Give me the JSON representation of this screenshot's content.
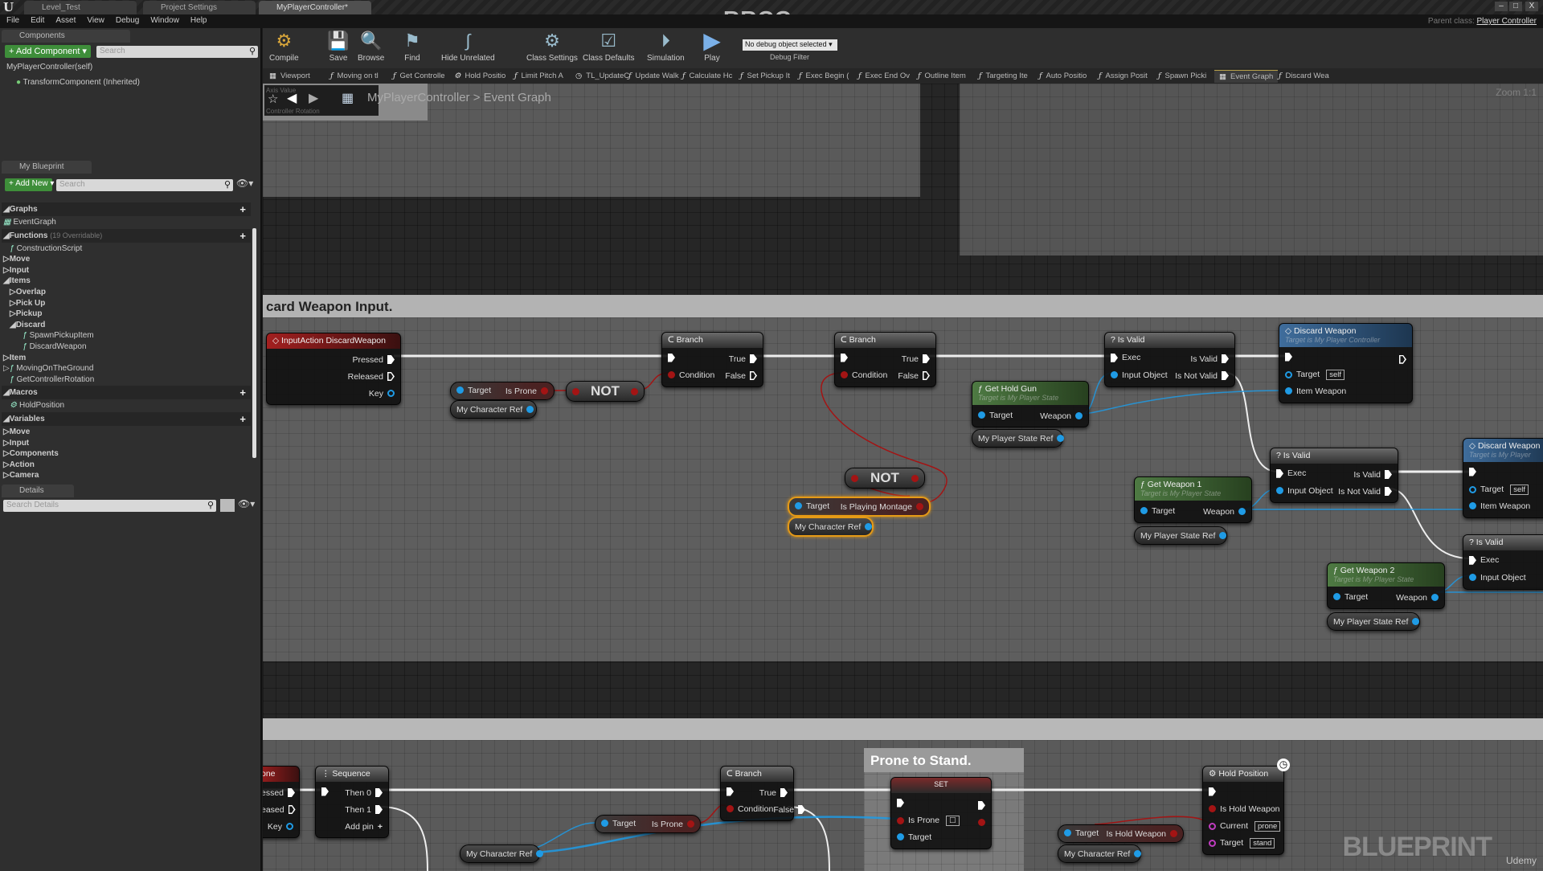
{
  "window": {
    "logo": "U",
    "watermark": "RRCG",
    "tabs": [
      "Level_Test",
      "Project Settings",
      "MyPlayerController*"
    ],
    "controls": [
      "–",
      "□",
      "X"
    ]
  },
  "menu": [
    "File",
    "Edit",
    "Asset",
    "View",
    "Debug",
    "Window",
    "Help"
  ],
  "parent_class": {
    "label": "Parent class:",
    "value": "Player Controller"
  },
  "components": {
    "tab": "Components",
    "add_button": "+ Add Component ▾",
    "search_placeholder": "Search",
    "items": [
      "MyPlayerController(self)",
      "TransformComponent (Inherited)"
    ]
  },
  "my_blueprint": {
    "tab": "My Blueprint",
    "add_button": "+ Add New ▾",
    "search_placeholder": "Search",
    "tree": [
      {
        "label": "Graphs",
        "kind": "hdr",
        "plus": true
      },
      {
        "label": "EventGraph",
        "kind": "item",
        "level": 0,
        "icon": "graph"
      },
      {
        "label": "Functions",
        "kind": "hdr",
        "plus": true,
        "note": "(19 Overridable)"
      },
      {
        "label": "ConstructionScript",
        "kind": "item",
        "level": 1,
        "icon": "func"
      },
      {
        "label": "Move",
        "kind": "cat",
        "level": 0,
        "arrow": "▷"
      },
      {
        "label": "Input",
        "kind": "cat",
        "level": 0,
        "arrow": "▷"
      },
      {
        "label": "Items",
        "kind": "cat",
        "level": 0,
        "arrow": "◢"
      },
      {
        "label": "Overlap",
        "kind": "cat",
        "level": 1,
        "arrow": "▷"
      },
      {
        "label": "Pick Up",
        "kind": "cat",
        "level": 1,
        "arrow": "▷"
      },
      {
        "label": "Pickup",
        "kind": "cat",
        "level": 1,
        "arrow": "▷"
      },
      {
        "label": "Discard",
        "kind": "cat",
        "level": 1,
        "arrow": "◢"
      },
      {
        "label": "SpawnPickupItem",
        "kind": "item",
        "level": 3,
        "icon": "func"
      },
      {
        "label": "DiscardWeapon",
        "kind": "item",
        "level": 3,
        "icon": "func"
      },
      {
        "label": "Item",
        "kind": "cat",
        "level": 0,
        "arrow": "▷"
      },
      {
        "label": "MovingOnTheGround",
        "kind": "item",
        "level": 0,
        "icon": "func",
        "arrow": "▷"
      },
      {
        "label": "GetControllerRotation",
        "kind": "item",
        "level": 1,
        "icon": "func"
      },
      {
        "label": "Macros",
        "kind": "hdr",
        "plus": true
      },
      {
        "label": "HoldPosition",
        "kind": "item",
        "level": 1,
        "icon": "macro"
      },
      {
        "label": "Variables",
        "kind": "hdr",
        "plus": true
      },
      {
        "label": "Move",
        "kind": "cat",
        "level": 0,
        "arrow": "▷"
      },
      {
        "label": "Input",
        "kind": "cat",
        "level": 0,
        "arrow": "▷"
      },
      {
        "label": "Components",
        "kind": "cat",
        "level": 0,
        "arrow": "▷"
      },
      {
        "label": "Action",
        "kind": "cat",
        "level": 0,
        "arrow": "▷"
      },
      {
        "label": "Camera",
        "kind": "cat",
        "level": 0,
        "arrow": "▷"
      }
    ]
  },
  "details": {
    "tab": "Details",
    "search_placeholder": "Search Details"
  },
  "toolbar": {
    "buttons": [
      "Compile",
      "Save",
      "Browse",
      "Find",
      "Hide Unrelated",
      "Class Settings",
      "Class Defaults",
      "Simulation",
      "Play"
    ],
    "debug_select": "No debug object selected ▾",
    "debug_filter": "Debug Filter"
  },
  "graph_tabs": [
    {
      "label": "Viewport",
      "icon": "viewport"
    },
    {
      "label": "Moving on tl",
      "icon": "func"
    },
    {
      "label": "Get Controlle",
      "icon": "func"
    },
    {
      "label": "Hold Positio",
      "icon": "macro"
    },
    {
      "label": "Limit Pitch A",
      "icon": "func"
    },
    {
      "label": "TL_UpdateC",
      "icon": "timeline"
    },
    {
      "label": "Update Walk",
      "icon": "func"
    },
    {
      "label": "Calculate Hc",
      "icon": "func"
    },
    {
      "label": "Set Pickup It",
      "icon": "func"
    },
    {
      "label": "Exec Begin (",
      "icon": "func"
    },
    {
      "label": "Exec End Ov",
      "icon": "func"
    },
    {
      "label": "Outline Item",
      "icon": "func"
    },
    {
      "label": "Targeting Ite",
      "icon": "func"
    },
    {
      "label": "Auto Positio",
      "icon": "func"
    },
    {
      "label": "Assign Posit",
      "icon": "func"
    },
    {
      "label": "Spawn Picki",
      "icon": "func"
    },
    {
      "label": "Event Graph",
      "icon": "graph",
      "active": true
    },
    {
      "label": "Discard Wea",
      "icon": "func"
    }
  ],
  "breadcrumb": {
    "class": "MyPlayerController",
    "separator": ">",
    "graph": "Event Graph",
    "popup_top": "Axis Value",
    "popup_bottom": "Controller Rotation"
  },
  "zoom_label": "Zoom 1:1",
  "comments": {
    "discard": "card Weapon Input.",
    "prone": "Prone to Stand."
  },
  "nodes": [
    {
      "id": "input-discard",
      "type": "event",
      "icon": "◇",
      "title": "InputAction DiscardWeapon",
      "rows": [
        [
          null,
          [
            "exec",
            "Pressed"
          ]
        ],
        [
          null,
          [
            "execo",
            "Released"
          ]
        ],
        [
          null,
          [
            "objo",
            "Key"
          ]
        ]
      ]
    },
    {
      "id": "is-prone-1",
      "type": "pure",
      "rows": [
        [
          [
            "obj",
            "Target"
          ],
          [
            "bool",
            "Is Prone"
          ]
        ]
      ]
    },
    {
      "id": "char-ref-1",
      "type": "var",
      "rows": [
        [
          null,
          [
            "obj",
            "My Character Ref"
          ]
        ]
      ]
    },
    {
      "id": "not-1",
      "type": "op",
      "title": "NOT"
    },
    {
      "id": "branch-1",
      "type": "flow",
      "icon": "ᑕ",
      "title": "Branch",
      "rows": [
        [
          [
            "exec",
            ""
          ],
          [
            "exec",
            "True"
          ]
        ],
        [
          [
            "bool",
            "Condition"
          ],
          [
            "execo",
            "False"
          ]
        ]
      ]
    },
    {
      "id": "branch-2",
      "type": "flow",
      "icon": "ᑕ",
      "title": "Branch",
      "rows": [
        [
          [
            "exec",
            ""
          ],
          [
            "exec",
            "True"
          ]
        ],
        [
          [
            "bool",
            "Condition"
          ],
          [
            "execo",
            "False"
          ]
        ]
      ]
    },
    {
      "id": "not-2",
      "type": "op",
      "title": "NOT"
    },
    {
      "id": "is-playing-montage",
      "type": "pure",
      "selected": true,
      "rows": [
        [
          [
            "obj",
            "Target"
          ],
          [
            "bool",
            "Is Playing Montage"
          ]
        ]
      ]
    },
    {
      "id": "char-ref-2",
      "type": "var",
      "selected": true,
      "rows": [
        [
          null,
          [
            "obj",
            "My Character Ref"
          ]
        ]
      ]
    },
    {
      "id": "get-hold-gun",
      "type": "func",
      "icon": "ƒ",
      "title": "Get Hold Gun",
      "subtitle": "Target is My Player State",
      "rows": [
        [
          [
            "obj",
            "Target"
          ],
          [
            "obj",
            "Weapon"
          ]
        ]
      ]
    },
    {
      "id": "state-ref-1",
      "type": "var",
      "rows": [
        [
          null,
          [
            "obj",
            "My Player State Ref"
          ]
        ]
      ]
    },
    {
      "id": "is-valid-1",
      "type": "flow",
      "icon": "?",
      "title": "Is Valid",
      "rows": [
        [
          [
            "exec",
            "Exec"
          ],
          [
            "exec",
            "Is Valid"
          ]
        ],
        [
          [
            "obj",
            "Input Object"
          ],
          [
            "exec",
            "Is Not Valid"
          ]
        ]
      ]
    },
    {
      "id": "discard-weapon-1",
      "type": "call",
      "icon": "◇",
      "title": "Discard Weapon",
      "subtitle": "Target is My Player Controller",
      "rows": [
        [
          [
            "exec",
            ""
          ],
          [
            "execo",
            ""
          ]
        ],
        [
          [
            "objo",
            "Target",
            "self"
          ],
          null
        ],
        [
          [
            "obj",
            "Item Weapon"
          ],
          null
        ]
      ]
    },
    {
      "id": "is-valid-2",
      "type": "flow",
      "icon": "?",
      "title": "Is Valid",
      "rows": [
        [
          [
            "exec",
            "Exec"
          ],
          [
            "exec",
            "Is Valid"
          ]
        ],
        [
          [
            "obj",
            "Input Object"
          ],
          [
            "exec",
            "Is Not Valid"
          ]
        ]
      ]
    },
    {
      "id": "get-weapon-1",
      "type": "func",
      "icon": "ƒ",
      "title": "Get Weapon 1",
      "subtitle": "Target is My Player State",
      "rows": [
        [
          [
            "obj",
            "Target"
          ],
          [
            "obj",
            "Weapon"
          ]
        ]
      ]
    },
    {
      "id": "state-ref-2",
      "type": "var",
      "rows": [
        [
          null,
          [
            "obj",
            "My Player State Ref"
          ]
        ]
      ]
    },
    {
      "id": "discard-weapon-2",
      "type": "call",
      "icon": "◇",
      "title": "Discard Weapon",
      "subtitle": "Target is My Player",
      "rows": [
        [
          [
            "exec",
            ""
          ],
          null
        ],
        [
          [
            "objo",
            "Target",
            "self"
          ],
          null
        ],
        [
          [
            "obj",
            "Item Weapon"
          ],
          null
        ]
      ]
    },
    {
      "id": "is-valid-3",
      "type": "flow",
      "icon": "?",
      "title": "Is Valid",
      "rows": [
        [
          [
            "exec",
            "Exec"
          ],
          null
        ],
        [
          [
            "obj",
            "Input Object"
          ],
          null
        ]
      ]
    },
    {
      "id": "get-weapon-2",
      "type": "func",
      "icon": "ƒ",
      "title": "Get Weapon 2",
      "subtitle": "Target is My Player State",
      "rows": [
        [
          [
            "obj",
            "Target"
          ],
          [
            "obj",
            "Weapon"
          ]
        ]
      ]
    },
    {
      "id": "state-ref-3",
      "type": "var",
      "rows": [
        [
          null,
          [
            "obj",
            "My Player State Ref"
          ]
        ]
      ]
    },
    {
      "id": "input-prone",
      "type": "event",
      "title": "one",
      "rows": [
        [
          null,
          [
            "exec",
            "essed"
          ]
        ],
        [
          null,
          [
            "execo",
            "eased"
          ]
        ],
        [
          null,
          [
            "objo",
            "Key"
          ]
        ]
      ]
    },
    {
      "id": "sequence",
      "type": "flow",
      "icon": "⋮",
      "title": "Sequence",
      "rows": [
        [
          [
            "exec",
            ""
          ],
          [
            "exec",
            "Then 0"
          ]
        ],
        [
          null,
          [
            "exec",
            "Then 1"
          ]
        ],
        [
          null,
          [
            "add",
            "Add pin"
          ]
        ]
      ]
    },
    {
      "id": "is-prone-2",
      "type": "pure",
      "rows": [
        [
          [
            "obj",
            "Target"
          ],
          [
            "bool",
            "Is Prone"
          ]
        ]
      ]
    },
    {
      "id": "char-ref-3",
      "type": "var",
      "rows": [
        [
          null,
          [
            "obj",
            "My Character Ref"
          ]
        ]
      ]
    },
    {
      "id": "branch-3",
      "type": "flow",
      "icon": "ᑕ",
      "title": "Branch",
      "rows": [
        [
          [
            "exec",
            ""
          ],
          [
            "exec",
            "True"
          ]
        ],
        [
          [
            "bool",
            "Condition"
          ],
          [
            "exec",
            "False"
          ]
        ]
      ]
    },
    {
      "id": "set-prone",
      "type": "set",
      "title": "SET",
      "rows": [
        [
          [
            "exec",
            ""
          ],
          [
            "exec",
            ""
          ]
        ],
        [
          [
            "bool",
            "Is Prone",
            "☐"
          ],
          [
            "bool",
            ""
          ]
        ],
        [
          [
            "obj",
            "Target"
          ],
          null
        ]
      ]
    },
    {
      "id": "is-hold-weapon",
      "type": "pure",
      "rows": [
        [
          [
            "obj",
            "Target"
          ],
          [
            "bool",
            "Is Hold Weapon"
          ]
        ]
      ]
    },
    {
      "id": "char-ref-4",
      "type": "var",
      "rows": [
        [
          null,
          [
            "obj",
            "My Character Ref"
          ]
        ]
      ]
    },
    {
      "id": "hold-position",
      "type": "flow",
      "icon": "⚙",
      "title": "Hold Position",
      "rows": [
        [
          [
            "exec",
            ""
          ],
          null
        ],
        [
          [
            "bool",
            "Is Hold Weapon"
          ],
          null
        ],
        [
          [
            "name",
            "Current",
            "prone"
          ],
          null
        ],
        [
          [
            "name",
            "Target",
            "stand"
          ],
          null
        ]
      ]
    }
  ],
  "watermarks": {
    "blueprint": "BLUEPRINT",
    "udemy": "Udemy"
  }
}
